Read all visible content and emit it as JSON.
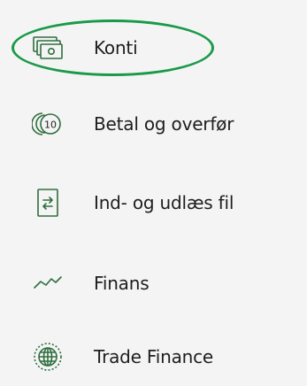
{
  "nav": {
    "items": [
      {
        "label": "Konti",
        "icon": "accounts-icon"
      },
      {
        "label": "Betal og overfør",
        "icon": "coin-transfer-icon"
      },
      {
        "label": "Ind- og udlæs fil",
        "icon": "file-transfer-icon"
      },
      {
        "label": "Finans",
        "icon": "chart-line-icon"
      },
      {
        "label": "Trade Finance",
        "icon": "globe-icon"
      }
    ],
    "highlight_color": "#1a9a49"
  }
}
